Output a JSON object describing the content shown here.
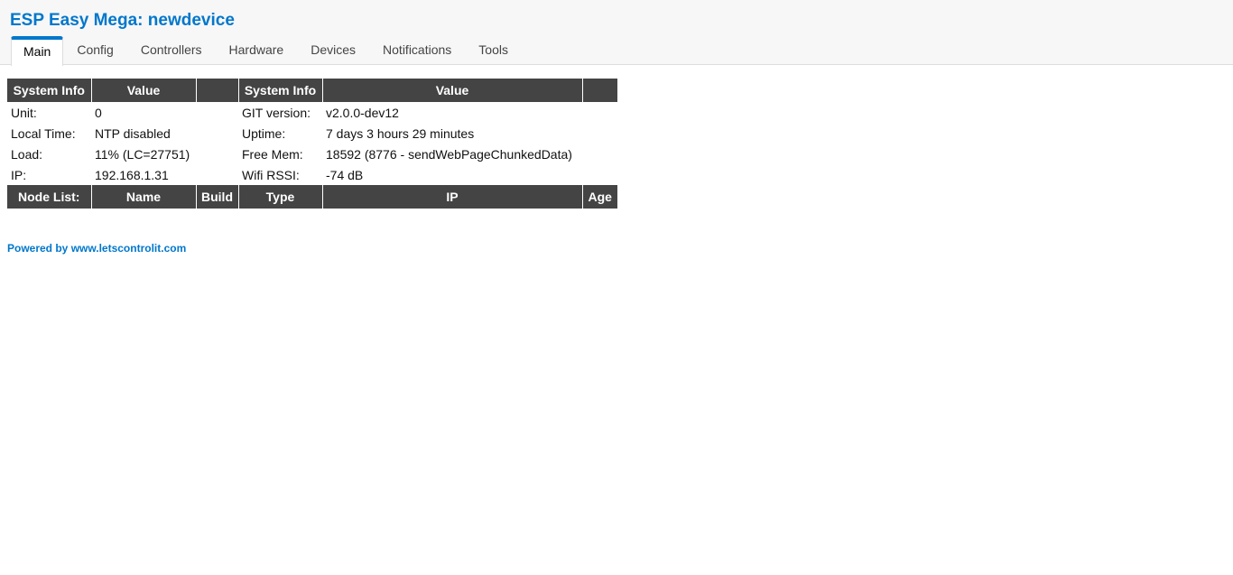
{
  "app": {
    "title": "ESP Easy Mega: newdevice"
  },
  "nav": {
    "tabs": [
      {
        "label": "Main",
        "active": true
      },
      {
        "label": "Config",
        "active": false
      },
      {
        "label": "Controllers",
        "active": false
      },
      {
        "label": "Hardware",
        "active": false
      },
      {
        "label": "Devices",
        "active": false
      },
      {
        "label": "Notifications",
        "active": false
      },
      {
        "label": "Tools",
        "active": false
      }
    ]
  },
  "sysinfo": {
    "headers": [
      "System Info",
      "Value",
      "",
      "System Info",
      "Value",
      ""
    ],
    "rows": [
      {
        "label1": "Unit:",
        "value1": "0",
        "label2": "GIT version:",
        "value2": "v2.0.0-dev12"
      },
      {
        "label1": "Local Time:",
        "value1": "NTP disabled",
        "label2": "Uptime:",
        "value2": "7 days 3 hours 29 minutes"
      },
      {
        "label1": "Load:",
        "value1": "11% (LC=27751)",
        "label2": "Free Mem:",
        "value2": "18592 (8776 - sendWebPageChunkedData)"
      },
      {
        "label1": "IP:",
        "value1": "192.168.1.31",
        "label2": "Wifi RSSI:",
        "value2": "-74 dB"
      }
    ]
  },
  "nodelist": {
    "headers": [
      "Node List:",
      "Name",
      "Build",
      "Type",
      "IP",
      "Age"
    ]
  },
  "footer": {
    "text": "Powered by www.letscontrolit.com"
  },
  "colors": {
    "accent": "#0077cc",
    "table_header": "#444444",
    "header_bg": "#f7f7f7"
  }
}
